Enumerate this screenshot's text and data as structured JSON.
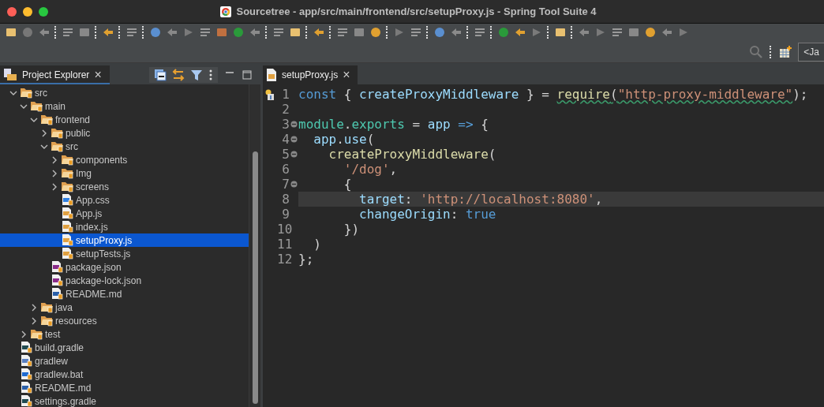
{
  "window": {
    "title": "Sourcetree - app/src/main/frontend/src/setupProxy.js - Spring Tool Suite 4"
  },
  "perspective_field": {
    "value": "<Ja"
  },
  "explorer": {
    "tab": {
      "label": "Project Explorer",
      "selected": true,
      "close": "×"
    },
    "tree": [
      {
        "label": "src",
        "kind": "folder",
        "expanded": true,
        "selected": false,
        "children": [
          {
            "label": "main",
            "kind": "folder",
            "expanded": true,
            "selected": false,
            "children": [
              {
                "label": "frontend",
                "kind": "folder",
                "expanded": true,
                "selected": false,
                "children": [
                  {
                    "label": "public",
                    "kind": "folder",
                    "expanded": false,
                    "selected": false
                  },
                  {
                    "label": "src",
                    "kind": "folder",
                    "expanded": true,
                    "selected": false,
                    "children": [
                      {
                        "label": "components",
                        "kind": "folder",
                        "expanded": false,
                        "selected": false
                      },
                      {
                        "label": "Img",
                        "kind": "folder",
                        "expanded": false,
                        "selected": false
                      },
                      {
                        "label": "screens",
                        "kind": "folder",
                        "expanded": false,
                        "selected": false
                      },
                      {
                        "label": "App.css",
                        "kind": "css",
                        "selected": false
                      },
                      {
                        "label": "App.js",
                        "kind": "js",
                        "selected": false
                      },
                      {
                        "label": "index.js",
                        "kind": "js",
                        "selected": false
                      },
                      {
                        "label": "setupProxy.js",
                        "kind": "js",
                        "selected": true
                      },
                      {
                        "label": "setupTests.js",
                        "kind": "js",
                        "selected": false
                      }
                    ]
                  },
                  {
                    "label": "package.json",
                    "kind": "json",
                    "selected": false
                  },
                  {
                    "label": "package-lock.json",
                    "kind": "json",
                    "selected": false
                  },
                  {
                    "label": "README.md",
                    "kind": "md",
                    "selected": false
                  }
                ]
              },
              {
                "label": "java",
                "kind": "folder",
                "expanded": false,
                "selected": false
              },
              {
                "label": "resources",
                "kind": "folder",
                "expanded": false,
                "selected": false
              }
            ]
          },
          {
            "label": "test",
            "kind": "folder",
            "expanded": false,
            "selected": false
          }
        ]
      },
      {
        "label": "build.gradle",
        "kind": "gradle",
        "selected": false
      },
      {
        "label": "gradlew",
        "kind": "file",
        "selected": false
      },
      {
        "label": "gradlew.bat",
        "kind": "bat",
        "selected": false
      },
      {
        "label": "README.md",
        "kind": "md",
        "selected": false
      },
      {
        "label": "settings.gradle",
        "kind": "gradle",
        "selected": false
      }
    ]
  },
  "editor": {
    "tab": {
      "label": "setupProxy.js",
      "selected": true,
      "close": "×"
    },
    "lines": [
      {
        "number": "1",
        "marker": true,
        "fold": false,
        "current": false,
        "tokens": [
          {
            "text": "const",
            "kind": "keyword"
          },
          {
            "text": " { ",
            "kind": "plain"
          },
          {
            "text": "createProxyMiddleware",
            "kind": "ident"
          },
          {
            "text": " } = ",
            "kind": "plain"
          },
          {
            "text": "require",
            "kind": "func",
            "warn": true
          },
          {
            "text": "(",
            "kind": "plain",
            "warn": true
          },
          {
            "text": "\"http-proxy-middleware\"",
            "kind": "string",
            "warn": true
          },
          {
            "text": ");",
            "kind": "plain"
          }
        ]
      },
      {
        "number": "2",
        "marker": false,
        "fold": false,
        "current": false
      },
      {
        "number": "3",
        "marker": false,
        "fold": true,
        "current": false,
        "tokens": [
          {
            "text": "module",
            "kind": "module"
          },
          {
            "text": ".",
            "kind": "plain"
          },
          {
            "text": "exports",
            "kind": "module"
          },
          {
            "text": " = ",
            "kind": "plain"
          },
          {
            "text": "app",
            "kind": "ident"
          },
          {
            "text": " => ",
            "kind": "keyword"
          },
          {
            "text": "{",
            "kind": "plain"
          }
        ]
      },
      {
        "number": "4",
        "marker": false,
        "fold": true,
        "current": false,
        "tokens": [
          {
            "text": "  app",
            "kind": "ident"
          },
          {
            "text": ".",
            "kind": "plain"
          },
          {
            "text": "use",
            "kind": "ident"
          },
          {
            "text": "(",
            "kind": "plain"
          }
        ]
      },
      {
        "number": "5",
        "marker": false,
        "fold": true,
        "current": false,
        "tokens": [
          {
            "text": "    createProxyMiddleware",
            "kind": "func"
          },
          {
            "text": "(",
            "kind": "plain"
          }
        ]
      },
      {
        "number": "6",
        "marker": false,
        "fold": false,
        "current": false,
        "tokens": [
          {
            "text": "      '/dog'",
            "kind": "string"
          },
          {
            "text": ",",
            "kind": "plain"
          }
        ]
      },
      {
        "number": "7",
        "marker": false,
        "fold": true,
        "current": false,
        "tokens": [
          {
            "text": "      {",
            "kind": "plain"
          }
        ]
      },
      {
        "number": "8",
        "marker": false,
        "fold": false,
        "current": true,
        "tokens": [
          {
            "text": "        target",
            "kind": "ident"
          },
          {
            "text": ": ",
            "kind": "plain"
          },
          {
            "text": "'http://localhost:8080'",
            "kind": "string"
          },
          {
            "text": ",",
            "kind": "plain"
          }
        ]
      },
      {
        "number": "9",
        "marker": false,
        "fold": false,
        "current": false,
        "tokens": [
          {
            "text": "        changeOrigin",
            "kind": "ident"
          },
          {
            "text": ": ",
            "kind": "plain"
          },
          {
            "text": "true",
            "kind": "keyword"
          }
        ]
      },
      {
        "number": "10",
        "marker": false,
        "fold": false,
        "current": false,
        "tokens": [
          {
            "text": "      })",
            "kind": "plain"
          }
        ]
      },
      {
        "number": "11",
        "marker": false,
        "fold": false,
        "current": false,
        "tokens": [
          {
            "text": "  )",
            "kind": "plain"
          }
        ]
      },
      {
        "number": "12",
        "marker": false,
        "fold": false,
        "current": false,
        "tokens": [
          {
            "text": "};",
            "kind": "plain"
          }
        ]
      }
    ]
  }
}
